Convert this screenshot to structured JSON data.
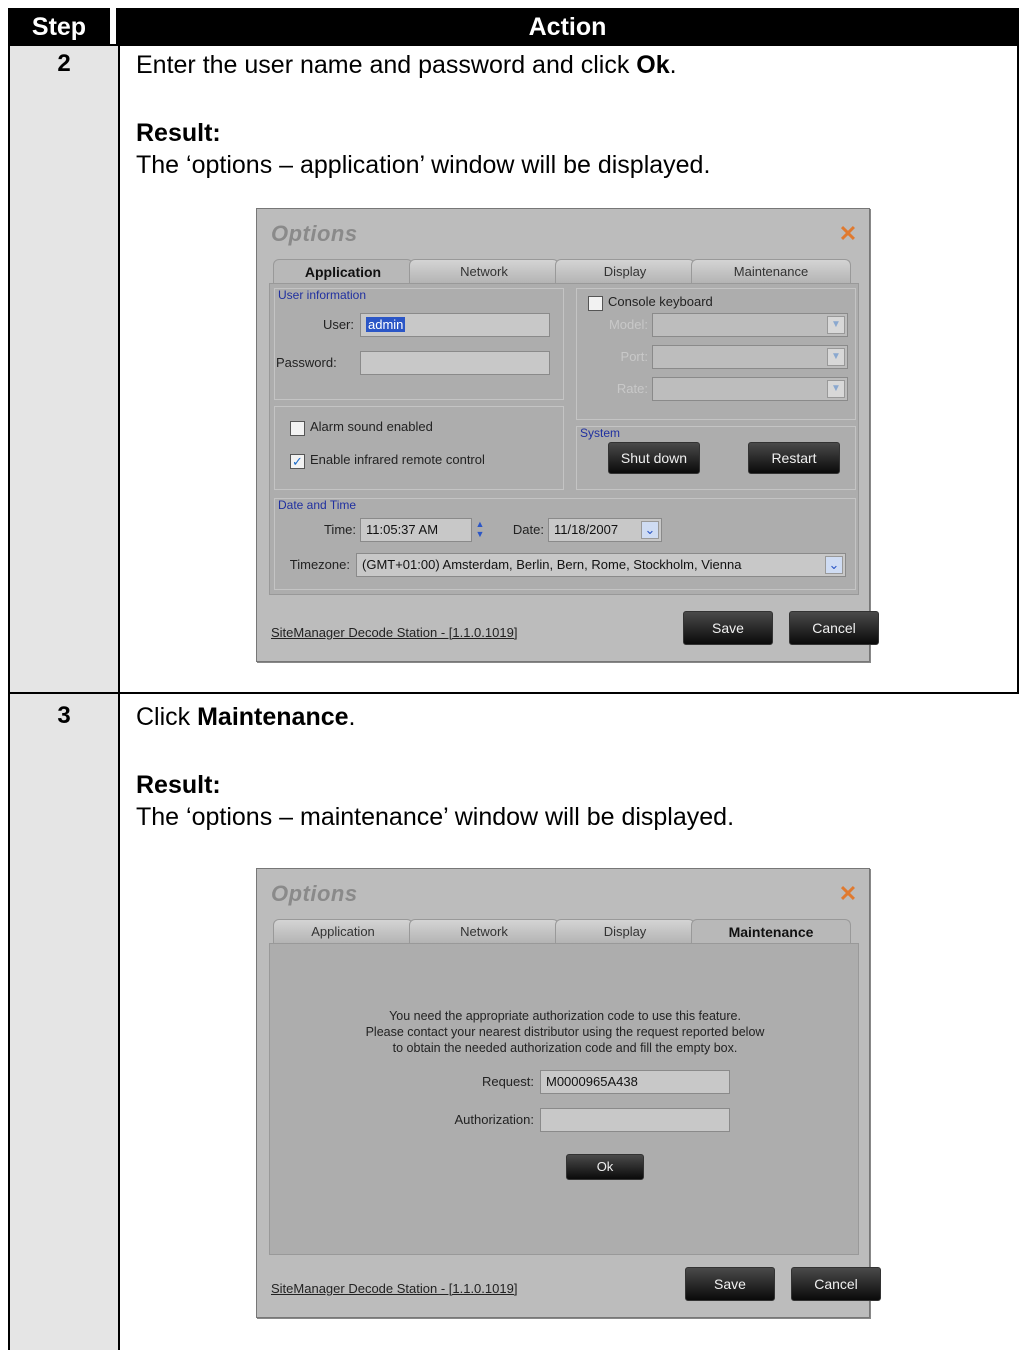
{
  "table": {
    "header_step": "Step",
    "header_action": "Action"
  },
  "rows": [
    {
      "step": "2",
      "instruction_pre": "Enter the user name and password and click ",
      "instruction_bold": "Ok",
      "instruction_post": ".",
      "result_label": "Result:",
      "result_text": "The ‘options – application’ window will be displayed."
    },
    {
      "step": "3",
      "instruction_pre": "Click ",
      "instruction_bold": "Maintenance",
      "instruction_post": ".",
      "result_label": "Result:",
      "result_text": "The ‘options – maintenance’ window will be displayed."
    }
  ],
  "window1": {
    "title": "Options",
    "close_icon": "close-icon",
    "tabs": [
      "Application",
      "Network",
      "Display",
      "Maintenance"
    ],
    "active_tab": "Application",
    "user_info_label": "User information",
    "user_label": "User:",
    "user_value": "admin",
    "password_label": "Password:",
    "password_value": "",
    "console_keyboard_label": "Console keyboard",
    "console_keyboard_checked": false,
    "model_label": "Model:",
    "port_label": "Port:",
    "rate_label": "Rate:",
    "alarm_sound_label": "Alarm sound enabled",
    "alarm_sound_checked": false,
    "infrared_label": "Enable infrared remote control",
    "infrared_checked": true,
    "system_label": "System",
    "shutdown_label": "Shut down",
    "restart_label": "Restart",
    "date_time_label": "Date and Time",
    "time_label": "Time:",
    "time_value": "11:05:37 AM",
    "date_label": "Date:",
    "date_value": "11/18/2007",
    "timezone_label": "Timezone:",
    "timezone_value": "(GMT+01:00) Amsterdam, Berlin, Bern, Rome, Stockholm, Vienna",
    "footer_link": "SiteManager Decode Station - [1.1.0.1019]",
    "save_label": "Save",
    "cancel_label": "Cancel"
  },
  "window2": {
    "title": "Options",
    "close_icon": "close-icon",
    "tabs": [
      "Application",
      "Network",
      "Display",
      "Maintenance"
    ],
    "active_tab": "Maintenance",
    "message_line1": "You need the appropriate authorization code to use this feature.",
    "message_line2": "Please contact your nearest distributor using the request reported below",
    "message_line3": "to obtain the needed authorization code and fill the empty box.",
    "request_label": "Request:",
    "request_value": "M0000965A438",
    "authorization_label": "Authorization:",
    "authorization_value": "",
    "ok_label": "Ok",
    "footer_link": "SiteManager Decode Station - [1.1.0.1019]",
    "save_label": "Save",
    "cancel_label": "Cancel"
  },
  "colors": {
    "header_bg": "#000000",
    "step_column_bg": "#e5e5e5",
    "window_bg": "#bcbcbc",
    "close_icon": "#e07a30",
    "group_label": "#2030a0"
  }
}
